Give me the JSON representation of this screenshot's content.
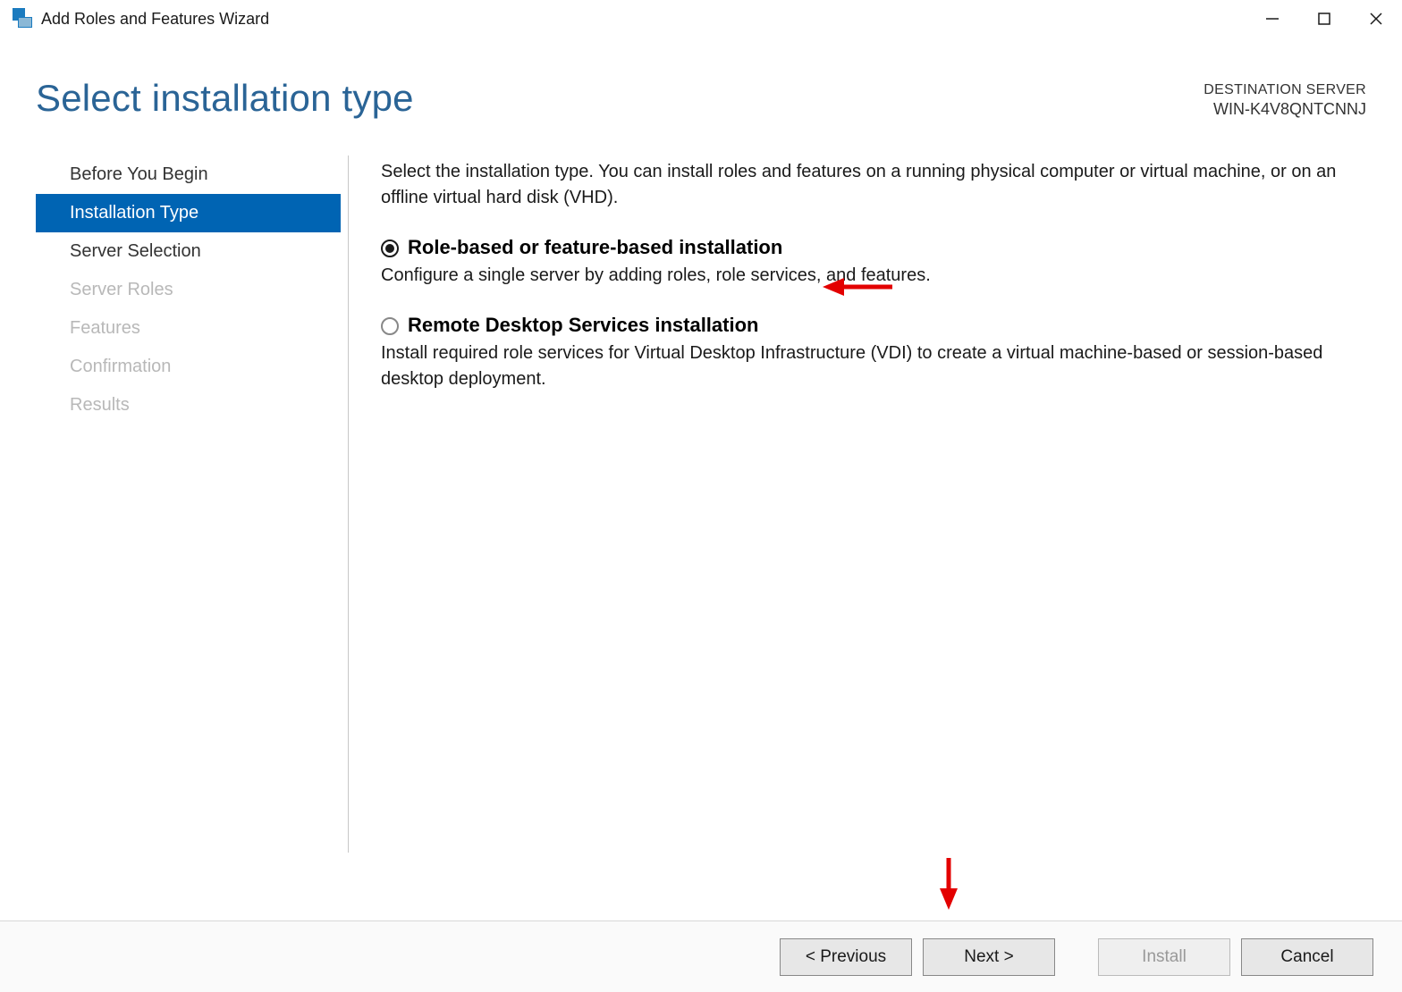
{
  "window": {
    "title": "Add Roles and Features Wizard"
  },
  "header": {
    "page_title": "Select installation type",
    "destination_label": "DESTINATION SERVER",
    "destination_server": "WIN-K4V8QNTCNNJ"
  },
  "sidebar": {
    "items": [
      {
        "label": "Before You Begin",
        "state": "normal"
      },
      {
        "label": "Installation Type",
        "state": "active"
      },
      {
        "label": "Server Selection",
        "state": "normal"
      },
      {
        "label": "Server Roles",
        "state": "disabled"
      },
      {
        "label": "Features",
        "state": "disabled"
      },
      {
        "label": "Confirmation",
        "state": "disabled"
      },
      {
        "label": "Results",
        "state": "disabled"
      }
    ]
  },
  "content": {
    "intro": "Select the installation type. You can install roles and features on a running physical computer or virtual machine, or on an offline virtual hard disk (VHD).",
    "options": [
      {
        "title": "Role-based or feature-based installation",
        "desc": "Configure a single server by adding roles, role services, and features.",
        "selected": true
      },
      {
        "title": "Remote Desktop Services installation",
        "desc": "Install required role services for Virtual Desktop Infrastructure (VDI) to create a virtual machine-based or session-based desktop deployment.",
        "selected": false
      }
    ]
  },
  "footer": {
    "previous": "< Previous",
    "next": "Next >",
    "install": "Install",
    "cancel": "Cancel"
  }
}
